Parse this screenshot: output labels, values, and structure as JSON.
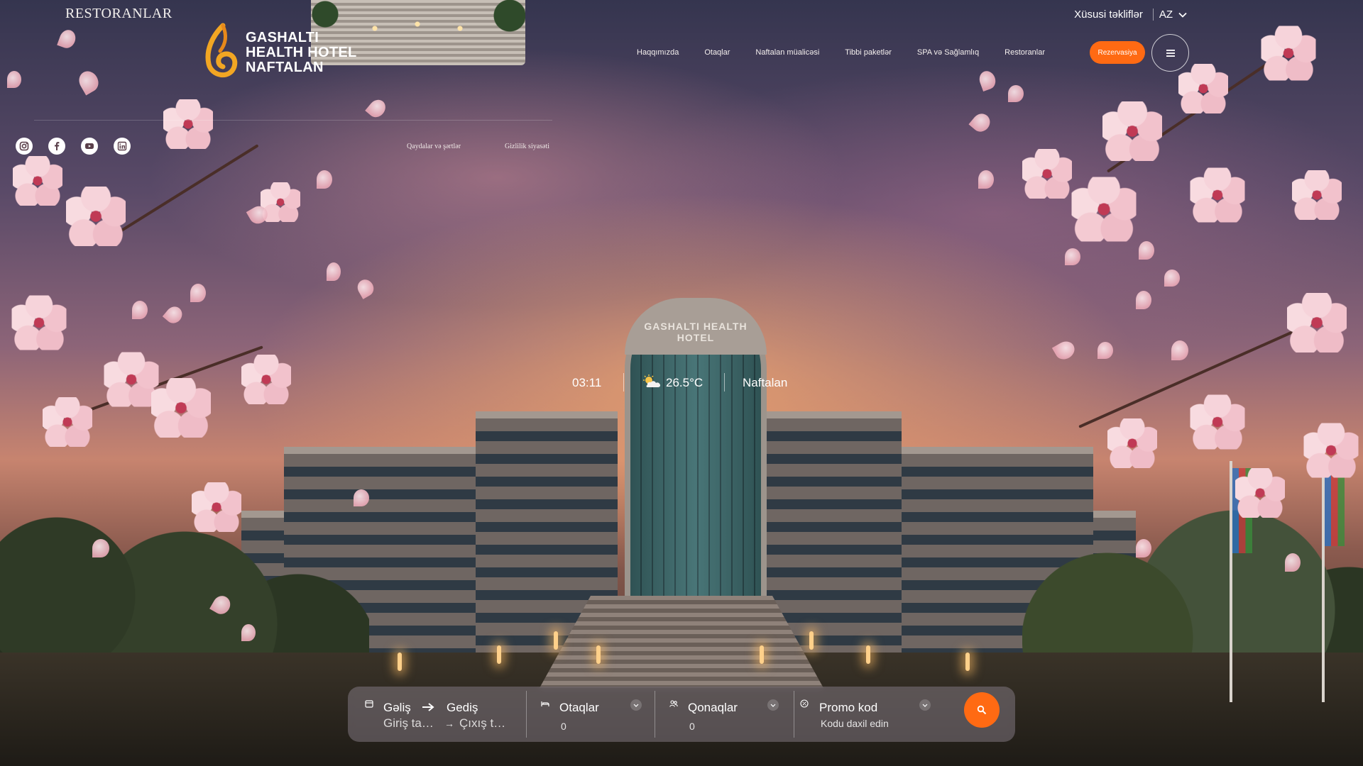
{
  "header": {
    "kicker": "RESTORANLAR",
    "logo": {
      "line1": "GASHALTI",
      "line2": "HEALTH HOTEL",
      "line3": "NAFTALAN"
    },
    "special_offers": "Xüsusi təkliflər",
    "language": "AZ",
    "nav": [
      {
        "label": "Haqqımızda"
      },
      {
        "label": "Otaqlar"
      },
      {
        "label": "Naftalan müalicəsi"
      },
      {
        "label": "Tibbi paketlər"
      },
      {
        "label": "SPA və Sağlamlıq"
      },
      {
        "label": "Restoranlar"
      }
    ],
    "reserve_label": "Rezervasiya"
  },
  "side_panel": {
    "socials": [
      "instagram-icon",
      "facebook-icon",
      "youtube-icon",
      "linkedin-icon"
    ],
    "terms": "Qaydalar və şərtlər",
    "privacy": "Gizlilik siyasəti"
  },
  "hero": {
    "building_sign": "GASHALTI HEALTH HOTEL",
    "time": "03:11",
    "temperature": "26.5°C",
    "location": "Naftalan"
  },
  "booking": {
    "arrival_label": "Gəliş",
    "departure_label": "Gediş",
    "checkin_placeholder": "Giriş ta…",
    "checkout_placeholder": "Çıxış t…",
    "rooms_label": "Otaqlar",
    "rooms_value": "0",
    "guests_label": "Qonaqlar",
    "guests_value": "0",
    "promo_label": "Promo kod",
    "promo_placeholder": "Kodu daxil edin"
  },
  "colors": {
    "accent": "#ff6a13",
    "logo_gold": "#f2a623"
  }
}
